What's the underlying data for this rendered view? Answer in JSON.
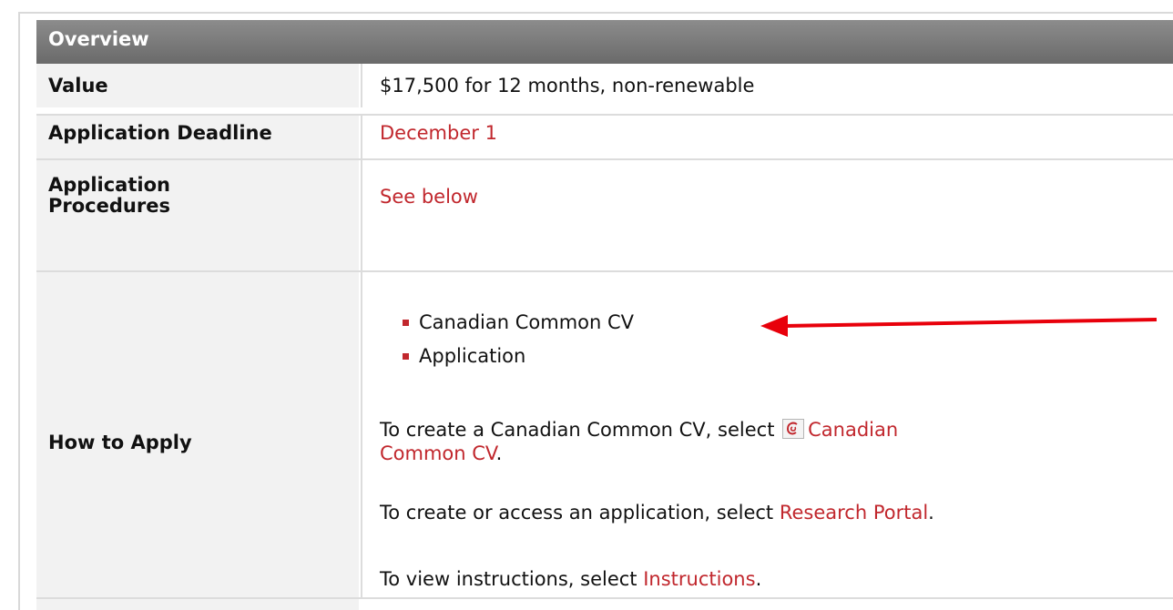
{
  "section": {
    "title": "Overview"
  },
  "rows": {
    "value": {
      "label": "Value",
      "text": "$17,500 for 12 months, non-renewable"
    },
    "deadline": {
      "label": "Application Deadline",
      "text": "December 1"
    },
    "procedures": {
      "label_line1": "Application",
      "label_line2": "Procedures",
      "text": "See below"
    },
    "how_to_apply": {
      "label": "How to Apply",
      "bullets": [
        "Canadian Common CV",
        "Application"
      ],
      "para1_prefix": "To create a Canadian Common CV, select ",
      "para1_link_line1": "Canadian",
      "para1_link_line2": "Common CV",
      "para1_suffix": ".",
      "para2_prefix": "To create or access an application, select ",
      "para2_link": "Research Portal",
      "para2_suffix": ".",
      "para3_prefix": "To view instructions, select ",
      "para3_link": "Instructions",
      "para3_suffix": "."
    }
  },
  "colors": {
    "link": "#c1272d",
    "header_bg": "#7a7a7a",
    "label_bg": "#f2f2f2",
    "annotation_arrow": "#e8000b"
  },
  "icons": {
    "ccv": "ccv-logo-icon"
  }
}
